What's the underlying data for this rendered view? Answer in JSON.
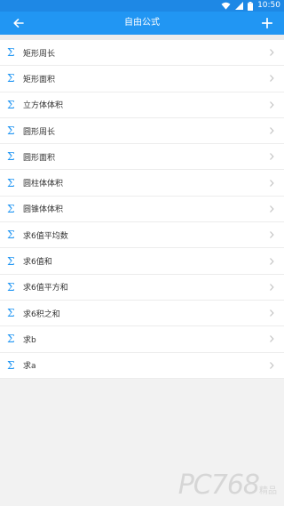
{
  "status_bar": {
    "time": "10:50"
  },
  "app_bar": {
    "title": "自由公式"
  },
  "formulas": [
    "矩形周长",
    "矩形面积",
    "立方体体积",
    "圆形周长",
    "圆形面积",
    "圆柱体体积",
    "圆锥体体积",
    "求6值平均数",
    "求6值和",
    "求6值平方和",
    "求6积之和",
    "求b",
    "求a"
  ],
  "item_icon": "sigma-icon",
  "watermark": {
    "text": "PC768",
    "sub": "精品"
  },
  "colors": {
    "accent": "#2196f3",
    "status_bar": "#1e88e5"
  }
}
